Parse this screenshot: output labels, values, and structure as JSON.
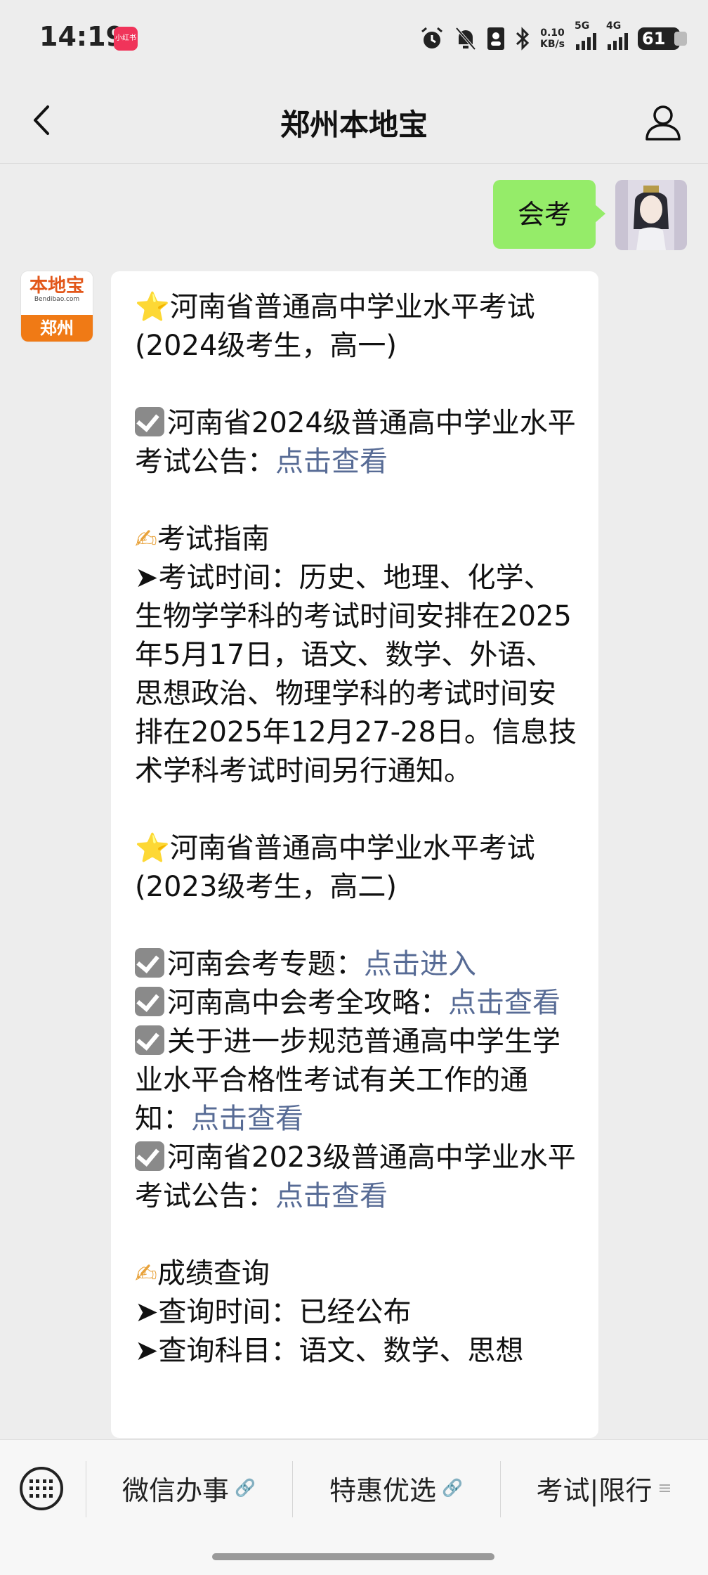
{
  "status": {
    "time": "14:19",
    "app_badge": "小红书",
    "net_speed_value": "0.10",
    "net_speed_unit": "KB/s",
    "signal1": "5G",
    "signal2": "4G",
    "battery": "61"
  },
  "header": {
    "title": "郑州本地宝"
  },
  "outgoing": {
    "text": "会考"
  },
  "bot": {
    "logo_text": "本地宝",
    "logo_url": "Bendibao.com",
    "city": "郑州"
  },
  "message": {
    "s1_title_a": "河南省普通高中学业水平考试",
    "s1_title_b": "(2024级考生，高一)",
    "s1_item1_text": "河南省2024级普通高中学业水平考试公告：",
    "s1_item1_link": "点击查看",
    "guide_title": "考试指南",
    "guide_body": "➤考试时间：历史、地理、化学、生物学学科的考试时间安排在2025年5月17日，语文、数学、外语、思想政治、物理学科的考试时间安排在2025年12月27-28日。信息技术学科考试时间另行通知。",
    "s2_title_a": "河南省普通高中学业水平考试",
    "s2_title_b": "(2023级考生，高二)",
    "s2_item1_text": "河南会考专题：",
    "s2_item1_link": "点击进入",
    "s2_item2_text": "河南高中会考全攻略：",
    "s2_item2_link": "点击查看",
    "s2_item3_text": "关于进一步规范普通高中学生学业水平合格性考试有关工作的通知：",
    "s2_item3_link": "点击查看",
    "s2_item4_text": "河南省2023级普通高中学业水平考试公告：",
    "s2_item4_link": "点击查看",
    "score_title": "成绩查询",
    "score_line1": "➤查询时间：已经公布",
    "score_line2": "➤查询科目：语文、数学、思想"
  },
  "bottom_menu": {
    "item1": "微信办事",
    "item2": "特惠优选",
    "item3": "考试|限行"
  },
  "colors": {
    "link": "#576b95",
    "bubble_out": "#95ec69",
    "background": "#ededed"
  }
}
